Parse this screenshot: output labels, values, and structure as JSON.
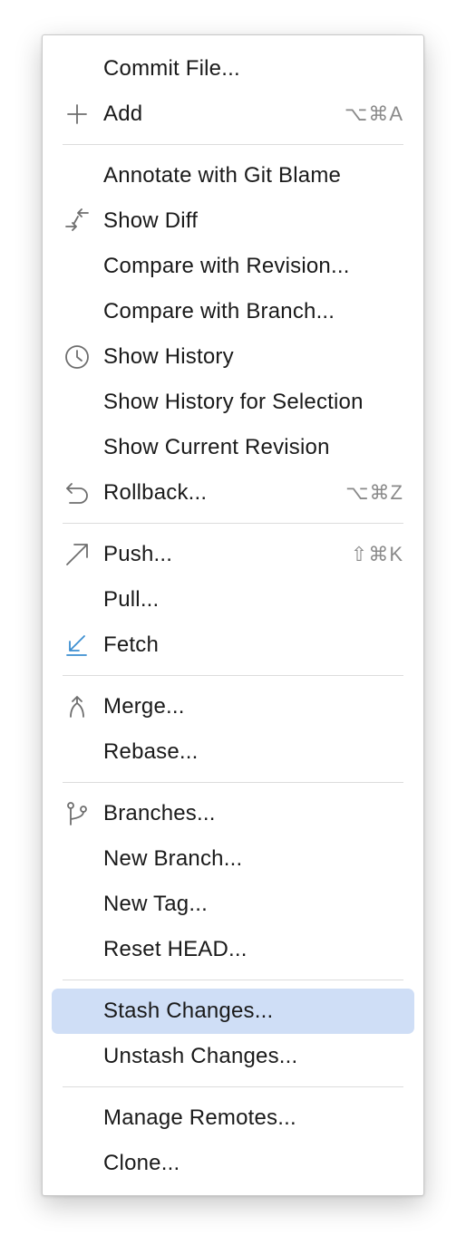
{
  "menu": {
    "groups": [
      {
        "items": [
          {
            "label": "Commit File...",
            "shortcut": "",
            "icon": ""
          },
          {
            "label": "Add",
            "shortcut": "⌥⌘A",
            "icon": "plus-icon"
          }
        ]
      },
      {
        "items": [
          {
            "label": "Annotate with Git Blame",
            "shortcut": "",
            "icon": ""
          },
          {
            "label": "Show Diff",
            "shortcut": "",
            "icon": "diff-arrows-icon"
          },
          {
            "label": "Compare with Revision...",
            "shortcut": "",
            "icon": ""
          },
          {
            "label": "Compare with Branch...",
            "shortcut": "",
            "icon": ""
          },
          {
            "label": "Show History",
            "shortcut": "",
            "icon": "clock-icon"
          },
          {
            "label": "Show History for Selection",
            "shortcut": "",
            "icon": ""
          },
          {
            "label": "Show Current Revision",
            "shortcut": "",
            "icon": ""
          },
          {
            "label": "Rollback...",
            "shortcut": "⌥⌘Z",
            "icon": "undo-arrow-icon"
          }
        ]
      },
      {
        "items": [
          {
            "label": "Push...",
            "shortcut": "⇧⌘K",
            "icon": "push-arrow-icon"
          },
          {
            "label": "Pull...",
            "shortcut": "",
            "icon": ""
          },
          {
            "label": "Fetch",
            "shortcut": "",
            "icon": "fetch-arrow-icon"
          }
        ]
      },
      {
        "items": [
          {
            "label": "Merge...",
            "shortcut": "",
            "icon": "merge-icon"
          },
          {
            "label": "Rebase...",
            "shortcut": "",
            "icon": ""
          }
        ]
      },
      {
        "items": [
          {
            "label": "Branches...",
            "shortcut": "",
            "icon": "branch-icon"
          },
          {
            "label": "New Branch...",
            "shortcut": "",
            "icon": ""
          },
          {
            "label": "New Tag...",
            "shortcut": "",
            "icon": ""
          },
          {
            "label": "Reset HEAD...",
            "shortcut": "",
            "icon": ""
          }
        ]
      },
      {
        "items": [
          {
            "label": "Stash Changes...",
            "shortcut": "",
            "icon": "",
            "highlighted": true
          },
          {
            "label": "Unstash Changes...",
            "shortcut": "",
            "icon": ""
          }
        ]
      },
      {
        "items": [
          {
            "label": "Manage Remotes...",
            "shortcut": "",
            "icon": ""
          },
          {
            "label": "Clone...",
            "shortcut": "",
            "icon": ""
          }
        ]
      }
    ]
  },
  "colors": {
    "highlight": "#cfdef6",
    "fetch_icon": "#3d8fd1",
    "icon_gray": "#6e6e6e",
    "shortcut_gray": "#8a8a8a"
  }
}
